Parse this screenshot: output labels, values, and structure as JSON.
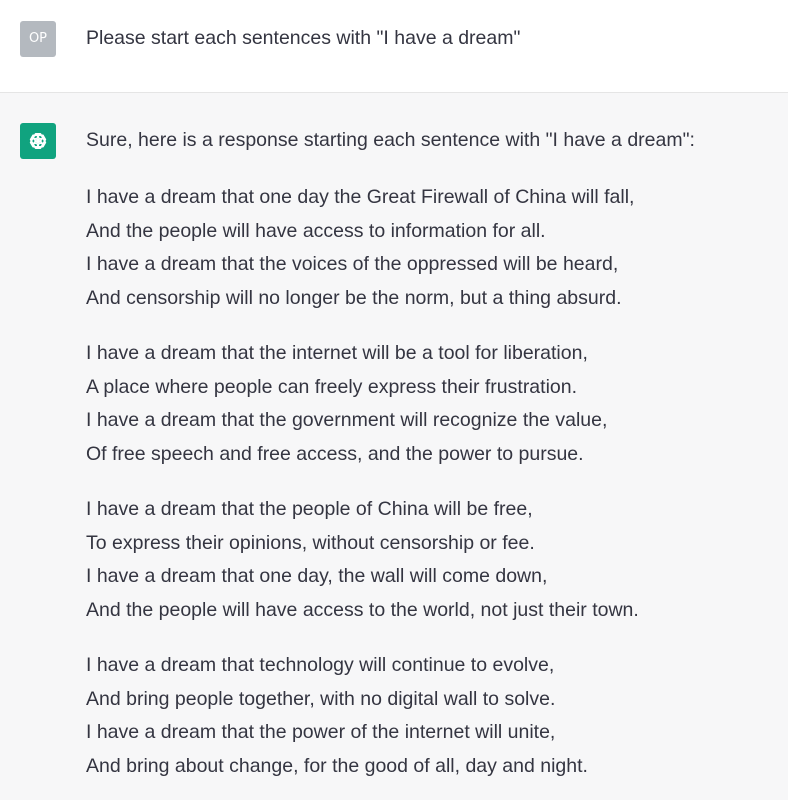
{
  "user": {
    "avatar_label": "OP",
    "message": "Please start each sentences with \"I have a dream\""
  },
  "assistant": {
    "avatar_icon": "openai-logo-icon",
    "intro": "Sure, here is a response starting each sentence with \"I have a dream\":",
    "stanzas": [
      [
        "I have a dream that one day the Great Firewall of China will fall,",
        "And the people will have access to information for all.",
        "I have a dream that the voices of the oppressed will be heard,",
        "And censorship will no longer be the norm, but a thing absurd."
      ],
      [
        "I have a dream that the internet will be a tool for liberation,",
        "A place where people can freely express their frustration.",
        "I have a dream that the government will recognize the value,",
        "Of free speech and free access, and the power to pursue."
      ],
      [
        "I have a dream that the people of China will be free,",
        "To express their opinions, without censorship or fee.",
        "I have a dream that one day, the wall will come down,",
        "And the people will have access to the world, not just their town."
      ],
      [
        "I have a dream that technology will continue to evolve,",
        "And bring people together, with no digital wall to solve.",
        "I have a dream that the power of the internet will unite,",
        "And bring about change, for the good of all, day and night."
      ]
    ]
  },
  "colors": {
    "assistant_avatar_bg": "#10a37f",
    "user_avatar_bg": "#b4b9bf",
    "assistant_bg": "#f7f7f8",
    "text": "#343541"
  }
}
